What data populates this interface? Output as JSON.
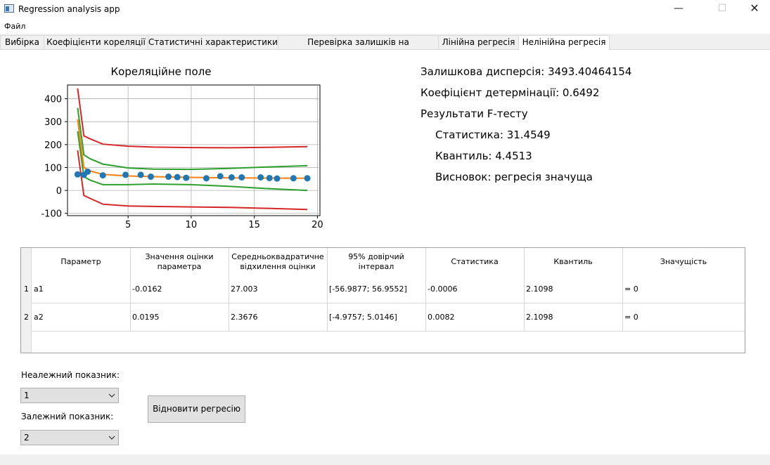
{
  "window": {
    "title": "Regression analysis app",
    "minimize": "—",
    "maximize": "☐",
    "close": "✕"
  },
  "menu": {
    "file": "Файл"
  },
  "tabs": [
    "Вибірка",
    "Коефіцієнти кореляції",
    "Статистичні характеристики",
    "Перевірка залишків на нормальність",
    "Лінійна регресія",
    "Нелінійна регресія"
  ],
  "stats": {
    "residual_variance": "Залишкова дисперсія: 3493.40464154",
    "determination": "Коефіцієнт детермінації: 0.6492",
    "ftest_title": "Результати F-тесту",
    "statistic": "Статистика: 31.4549",
    "quantile": "Квантиль: 4.4513",
    "conclusion": "Висновок: регресія значуща"
  },
  "table": {
    "columns": [
      "Параметр",
      "Значення оцінки параметра",
      "Середньоквадратичне відхилення оцінки",
      "95% довірчий інтервал",
      "Статистика",
      "Квантиль",
      "Значущість"
    ],
    "row_numbers": [
      "1",
      "2"
    ],
    "rows": [
      [
        "a1",
        "-0.0162",
        "27.003",
        "[-56.9877; 56.9552]",
        "-0.0006",
        "2.1098",
        "= 0"
      ],
      [
        "a2",
        "0.0195",
        "2.3676",
        "[-4.9757; 5.0146]",
        "0.0082",
        "2.1098",
        "= 0"
      ]
    ]
  },
  "controls": {
    "independent_label": "Неалежний показник:",
    "independent_value": "1",
    "dependent_label": "Залежний показник:",
    "dependent_value": "2",
    "restore_button": "Відновити регресію"
  },
  "colors": {
    "points": "#1f77b4",
    "regression": "#ff7f0e",
    "confidence": "#2ca02c",
    "tolerance": "#d62728"
  },
  "chart_data": {
    "type": "scatter",
    "title": "Кореляційне поле",
    "xlabel": "",
    "ylabel": "",
    "xlim": [
      0.2,
      20.2
    ],
    "ylim": [
      -110,
      460
    ],
    "xticks": [
      5,
      10,
      15,
      20
    ],
    "yticks": [
      -100,
      0,
      100,
      200,
      300,
      400
    ],
    "grid": true,
    "points": [
      [
        1.0,
        70
      ],
      [
        1.5,
        68
      ],
      [
        1.8,
        82
      ],
      [
        3.0,
        66
      ],
      [
        4.8,
        68
      ],
      [
        6.0,
        68
      ],
      [
        6.8,
        60
      ],
      [
        8.2,
        60
      ],
      [
        8.9,
        58
      ],
      [
        9.6,
        55
      ],
      [
        11.2,
        53
      ],
      [
        12.3,
        62
      ],
      [
        13.2,
        57
      ],
      [
        14.0,
        57
      ],
      [
        15.5,
        57
      ],
      [
        16.2,
        54
      ],
      [
        16.8,
        52
      ],
      [
        18.1,
        53
      ],
      [
        19.2,
        53
      ]
    ],
    "series": [
      {
        "role": "regression",
        "x": [
          1.0,
          1.5,
          2,
          3,
          5,
          7,
          10,
          13,
          16,
          19.2
        ],
        "y": [
          310,
          100,
          85,
          70,
          63,
          60,
          57,
          55,
          54,
          53
        ]
      },
      {
        "role": "confidence",
        "x": [
          1.0,
          1.5,
          2,
          3,
          5,
          7,
          10,
          13,
          16,
          19.2
        ],
        "y": [
          360,
          155,
          138,
          115,
          98,
          93,
          92,
          96,
          102,
          108
        ]
      },
      {
        "role": "confidence",
        "x": [
          1.0,
          1.5,
          2,
          3,
          5,
          7,
          10,
          13,
          16,
          19.2
        ],
        "y": [
          258,
          60,
          45,
          25,
          25,
          28,
          25,
          18,
          8,
          0
        ]
      },
      {
        "role": "tolerance",
        "x": [
          1.0,
          1.5,
          2,
          3,
          5,
          7,
          10,
          13,
          16,
          19.2
        ],
        "y": [
          445,
          238,
          225,
          202,
          193,
          189,
          187,
          186,
          188,
          191
        ]
      },
      {
        "role": "tolerance",
        "x": [
          1.0,
          1.5,
          2,
          3,
          5,
          7,
          10,
          13,
          16,
          19.2
        ],
        "y": [
          175,
          -22,
          -35,
          -60,
          -68,
          -70,
          -72,
          -74,
          -78,
          -83
        ]
      }
    ]
  }
}
